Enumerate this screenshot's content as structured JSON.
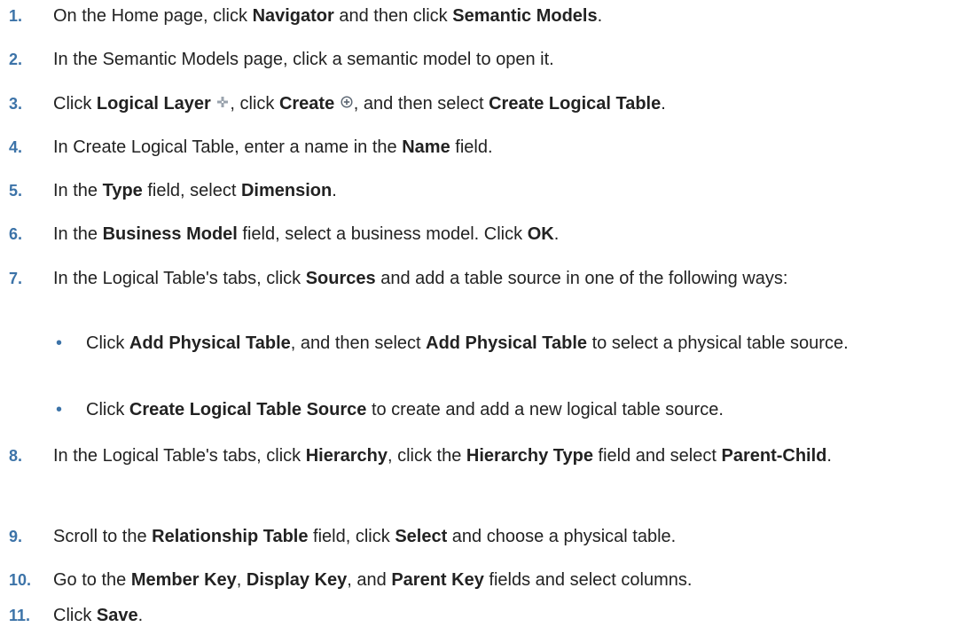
{
  "steps": [
    {
      "num": "1.",
      "parts": [
        {
          "t": "On the Home page, click "
        },
        {
          "t": "Navigator",
          "b": true
        },
        {
          "t": " and then click "
        },
        {
          "t": "Semantic Models",
          "b": true
        },
        {
          "t": "."
        }
      ]
    },
    {
      "num": "2.",
      "parts": [
        {
          "t": "In the Semantic Models page, click a semantic model to open it."
        }
      ]
    },
    {
      "num": "3.",
      "parts": [
        {
          "t": "Click "
        },
        {
          "t": "Logical Layer",
          "b": true
        },
        {
          "t": " "
        },
        {
          "icon": "logical-layer-icon"
        },
        {
          "t": ", click "
        },
        {
          "t": "Create",
          "b": true
        },
        {
          "t": " "
        },
        {
          "icon": "create-plus-circle-icon"
        },
        {
          "t": ", and then select "
        },
        {
          "t": "Create Logical Table",
          "b": true
        },
        {
          "t": "."
        }
      ]
    },
    {
      "num": "4.",
      "parts": [
        {
          "t": "In Create Logical Table, enter a name in the "
        },
        {
          "t": "Name",
          "b": true
        },
        {
          "t": " field."
        }
      ]
    },
    {
      "num": "5.",
      "parts": [
        {
          "t": "In the "
        },
        {
          "t": "Type",
          "b": true
        },
        {
          "t": " field, select "
        },
        {
          "t": "Dimension",
          "b": true
        },
        {
          "t": "."
        }
      ]
    },
    {
      "num": "6.",
      "parts": [
        {
          "t": "In the "
        },
        {
          "t": "Business Model",
          "b": true
        },
        {
          "t": " field, select a business model. Click "
        },
        {
          "t": "OK",
          "b": true
        },
        {
          "t": "."
        }
      ]
    },
    {
      "num": "7.",
      "parts": [
        {
          "t": "In the Logical Table's tabs, click "
        },
        {
          "t": "Sources",
          "b": true
        },
        {
          "t": " and add a table source in one of the following ways:"
        }
      ],
      "sub": [
        {
          "parts": [
            {
              "t": "Click "
            },
            {
              "t": "Add Physical Table",
              "b": true
            },
            {
              "t": ", and then select "
            },
            {
              "t": "Add Physical Table",
              "b": true
            },
            {
              "t": " to select a physical table source."
            }
          ]
        },
        {
          "parts": [
            {
              "t": "Click "
            },
            {
              "t": "Create Logical Table Source",
              "b": true
            },
            {
              "t": " to create and add a new logical table source."
            }
          ]
        }
      ]
    },
    {
      "num": "8.",
      "parts": [
        {
          "t": "In the Logical Table's tabs, click "
        },
        {
          "t": "Hierarchy",
          "b": true
        },
        {
          "t": ", click the "
        },
        {
          "t": "Hierarchy Type",
          "b": true
        },
        {
          "t": " field and select "
        },
        {
          "t": "Parent-Child",
          "b": true
        },
        {
          "t": "."
        }
      ]
    },
    {
      "num": "9.",
      "parts": [
        {
          "t": "Scroll to the "
        },
        {
          "t": "Relationship Table",
          "b": true
        },
        {
          "t": " field, click "
        },
        {
          "t": "Select",
          "b": true
        },
        {
          "t": " and choose a physical table."
        }
      ]
    },
    {
      "num": "10.",
      "parts": [
        {
          "t": "Go to the "
        },
        {
          "t": "Member Key",
          "b": true
        },
        {
          "t": ", "
        },
        {
          "t": "Display Key",
          "b": true
        },
        {
          "t": ", and "
        },
        {
          "t": "Parent Key",
          "b": true
        },
        {
          "t": " fields and select columns."
        }
      ]
    },
    {
      "num": "11.",
      "parts": [
        {
          "t": "Click "
        },
        {
          "t": "Save",
          "b": true
        },
        {
          "t": "."
        }
      ]
    }
  ]
}
